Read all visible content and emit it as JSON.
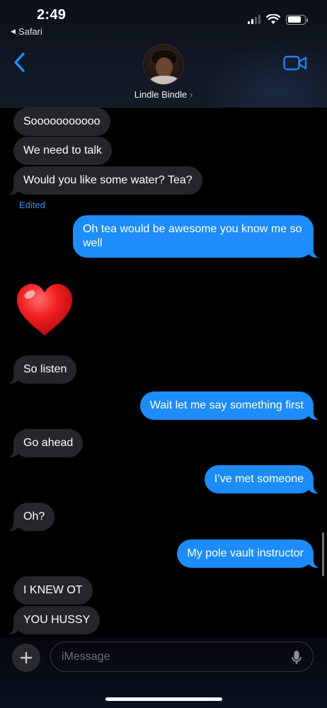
{
  "status_bar": {
    "time": "2:49",
    "back_app_label": "Safari",
    "icons": [
      "cellular-signal-icon",
      "wifi-icon",
      "battery-icon"
    ]
  },
  "header": {
    "contact_name": "Lindle Bindle",
    "icons": [
      "back-chevron-icon",
      "video-call-icon"
    ],
    "accent_color": "#1d8cf8"
  },
  "messages": [
    {
      "direction": "incoming",
      "text": "Sooooooooooo"
    },
    {
      "direction": "incoming",
      "text": "We need to talk"
    },
    {
      "direction": "incoming",
      "text": "Would you like some water? Tea?",
      "edited_label": "Edited"
    },
    {
      "direction": "outgoing",
      "text": "Oh tea would be awesome you know me so well"
    },
    {
      "direction": "incoming",
      "emoji": "red-heart-icon"
    },
    {
      "direction": "incoming",
      "text": "So listen"
    },
    {
      "direction": "outgoing",
      "text": "Wait let me say something first"
    },
    {
      "direction": "incoming",
      "text": "Go ahead"
    },
    {
      "direction": "outgoing",
      "text": "I’ve met someone"
    },
    {
      "direction": "incoming",
      "text": "Oh?"
    },
    {
      "direction": "outgoing",
      "text": "My pole vault instructor"
    },
    {
      "direction": "incoming",
      "text": "I KNEW OT"
    },
    {
      "direction": "incoming",
      "text": "YOU HUSSY"
    }
  ],
  "composer": {
    "placeholder": "iMessage",
    "icons": [
      "plus-icon",
      "microphone-icon"
    ]
  },
  "colors": {
    "incoming_bubble": "#26252a",
    "outgoing_bubble": "#1d8cf8",
    "background": "#000000"
  }
}
